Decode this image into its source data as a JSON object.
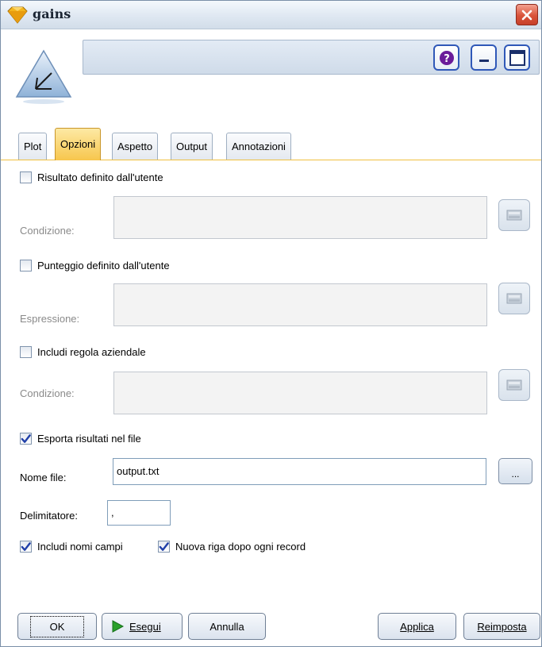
{
  "window": {
    "title": "gains"
  },
  "tabs": [
    {
      "label": "Plot",
      "active": false
    },
    {
      "label": "Opzioni",
      "active": true
    },
    {
      "label": "Aspetto",
      "active": false
    },
    {
      "label": "Output",
      "active": false
    },
    {
      "label": "Annotazioni",
      "active": false
    }
  ],
  "options": {
    "user_result": {
      "label": "Risultato definito dall'utente",
      "checked": false
    },
    "user_result_condition": {
      "label": "Condizione:",
      "value": ""
    },
    "user_score": {
      "label": "Punteggio definito dall'utente",
      "checked": false
    },
    "user_score_expression": {
      "label": "Espressione:",
      "value": ""
    },
    "business_rule": {
      "label": "Includi regola aziendale",
      "checked": false
    },
    "business_rule_condition": {
      "label": "Condizione:",
      "value": ""
    },
    "export": {
      "label": "Esporta risultati nel file",
      "checked": true
    },
    "file_name": {
      "label": "Nome file:",
      "value": "output.txt"
    },
    "browse_label": "...",
    "delimiter": {
      "label": "Delimitatore:",
      "value": ","
    },
    "include_field_names": {
      "label": "Includi nomi campi",
      "checked": true
    },
    "newline_after_record": {
      "label": "Nuova riga dopo ogni record",
      "checked": true
    }
  },
  "buttons": {
    "ok": "OK",
    "run": "Esegui",
    "cancel": "Annulla",
    "apply": "Applica",
    "reset": "Reimposta"
  },
  "colors": {
    "active_tab": "#f7c64d",
    "run_icon": "#2aa12a",
    "check": "#1f3fa8"
  }
}
